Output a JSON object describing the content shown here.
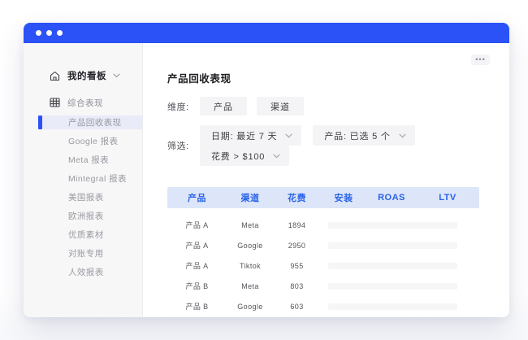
{
  "colors": {
    "titlebar": "#2B52F6",
    "accent": "#2B52F6",
    "table_header_bg": "#DCE6F8",
    "table_header_text": "#2A62E8",
    "sidebar_bg": "#F7F7F8",
    "selected_item_bg": "#E9EBF8"
  },
  "sidebar": {
    "header": {
      "label": "我的看板",
      "icon": "home-icon",
      "chevron": "chevron-down-icon"
    },
    "group": {
      "label": "综合表现",
      "icon": "grid-icon"
    },
    "items": [
      {
        "label": "产品回收表现",
        "selected": true
      },
      {
        "label": "Google 报表",
        "selected": false
      },
      {
        "label": "Meta 报表",
        "selected": false
      },
      {
        "label": "Mintegral 报表",
        "selected": false
      },
      {
        "label": "美国报表",
        "selected": false
      },
      {
        "label": "欧洲报表",
        "selected": false
      },
      {
        "label": "优质素材",
        "selected": false
      },
      {
        "label": "对账专用",
        "selected": false
      },
      {
        "label": "人效报表",
        "selected": false
      }
    ]
  },
  "main": {
    "title": "产品回收表现",
    "more_label": "•••",
    "dimension": {
      "label": "维度:",
      "chips": [
        "产品",
        "渠道"
      ]
    },
    "filters": {
      "label": "筛选:",
      "dropdowns": [
        "日期: 最近 7 天",
        "产品: 已选 5 个",
        "花费 > $100"
      ]
    },
    "table": {
      "headers": [
        "产品",
        "渠道",
        "花费",
        "安装",
        "ROAS",
        "LTV"
      ],
      "rows": [
        {
          "product": "产品 A",
          "channel": "Meta",
          "spend": "1894"
        },
        {
          "product": "产品 A",
          "channel": "Google",
          "spend": "2950"
        },
        {
          "product": "产品 A",
          "channel": "Tiktok",
          "spend": "955"
        },
        {
          "product": "产品 B",
          "channel": "Meta",
          "spend": "803"
        },
        {
          "product": "产品 B",
          "channel": "Google",
          "spend": "603"
        }
      ]
    }
  }
}
